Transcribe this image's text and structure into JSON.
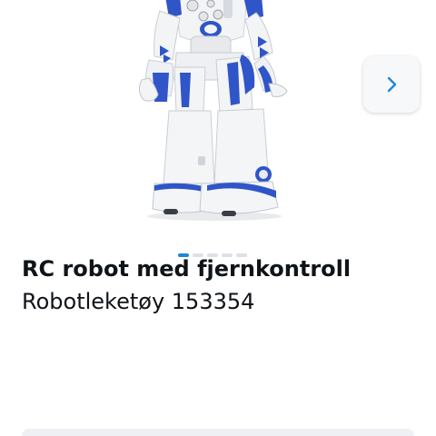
{
  "product": {
    "title": "RC robot med fjernkontroll",
    "subtitle": "Robotleketøy 153354"
  },
  "gallery": {
    "image_count": 5,
    "active_index": 0,
    "next_icon": "chevron-right-icon"
  },
  "colors": {
    "accent": "#1e88d6",
    "robot_blue": "#2f55c8",
    "robot_white": "#f2f3f5",
    "text": "#101418"
  }
}
